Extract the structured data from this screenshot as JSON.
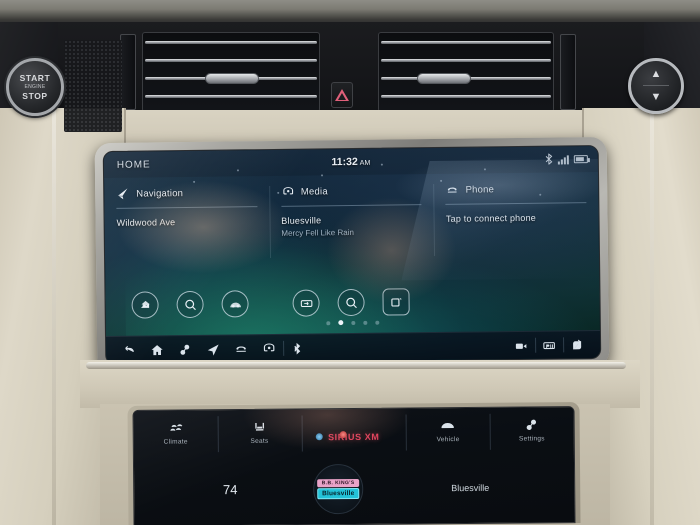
{
  "vehicle": {
    "start_stop": {
      "top": "START",
      "middle": "ENGINE",
      "bottom": "STOP"
    },
    "hazard": {
      "name": "hazard-lights"
    },
    "rocker": {
      "up": "▲",
      "down": "▼"
    }
  },
  "infotainment": {
    "header": {
      "title": "HOME",
      "clock_time": "11:32",
      "clock_ampm": "AM",
      "status_icons": [
        "bluetooth-icon",
        "signal-icon",
        "battery-icon"
      ]
    },
    "cards": [
      {
        "icon": "navigation-arrow-icon",
        "label": "Navigation",
        "line1": "Wildwood Ave",
        "line2": ""
      },
      {
        "icon": "media-icon",
        "label": "Media",
        "line1": "Bluesville",
        "line2": "Mercy Fell Like Rain"
      },
      {
        "icon": "phone-icon",
        "label": "Phone",
        "line1": "Tap to connect phone",
        "line2": ""
      }
    ],
    "shortcuts": [
      {
        "icon": "home-nav-icon",
        "name": "shortcut-home-destination"
      },
      {
        "icon": "search-icon",
        "name": "shortcut-search"
      },
      {
        "icon": "offroad-icon",
        "name": "shortcut-offroad"
      },
      {
        "icon": "media-source-icon",
        "name": "shortcut-media-source"
      },
      {
        "icon": "search-media-icon",
        "name": "shortcut-media-search"
      },
      {
        "icon": "apps-icon",
        "name": "shortcut-apps"
      }
    ],
    "page_dots": {
      "count": 5,
      "active_index": 1
    },
    "taskbar": [
      {
        "icon": "back-icon",
        "name": "taskbar-back"
      },
      {
        "icon": "home-icon",
        "name": "taskbar-home"
      },
      {
        "icon": "connections-icon",
        "name": "taskbar-connections"
      },
      {
        "icon": "navigation-icon",
        "name": "taskbar-navigation"
      },
      {
        "icon": "phone-icon",
        "name": "taskbar-phone"
      },
      {
        "icon": "media-icon",
        "name": "taskbar-media"
      },
      {
        "icon": "bluetooth-icon",
        "name": "taskbar-bluetooth"
      },
      {
        "icon": "camera-icon",
        "name": "taskbar-camera"
      },
      {
        "icon": "park-assist-icon",
        "name": "taskbar-park-assist"
      },
      {
        "icon": "share-icon",
        "name": "taskbar-share"
      }
    ]
  },
  "climate_screen": {
    "tabs": [
      {
        "icon": "climate-icon",
        "label": "Climate"
      },
      {
        "icon": "seats-icon",
        "label": "Seats"
      },
      {
        "icon": "vehicle-icon",
        "label": "Vehicle"
      },
      {
        "icon": "settings-icon",
        "label": "Settings"
      }
    ],
    "radio_brand": "SIRIUS XM",
    "temperature": "74",
    "album_art": {
      "line1": "B.B. KING'S",
      "line2": "Bluesville"
    },
    "station_name": "Bluesville"
  },
  "colors": {
    "dash_beige": "#d5cfbd",
    "screen_teal": "#0a2e2c",
    "accent_red": "#e2415c",
    "text_primary": "#e9eff5",
    "text_secondary": "#9fb3c4"
  }
}
